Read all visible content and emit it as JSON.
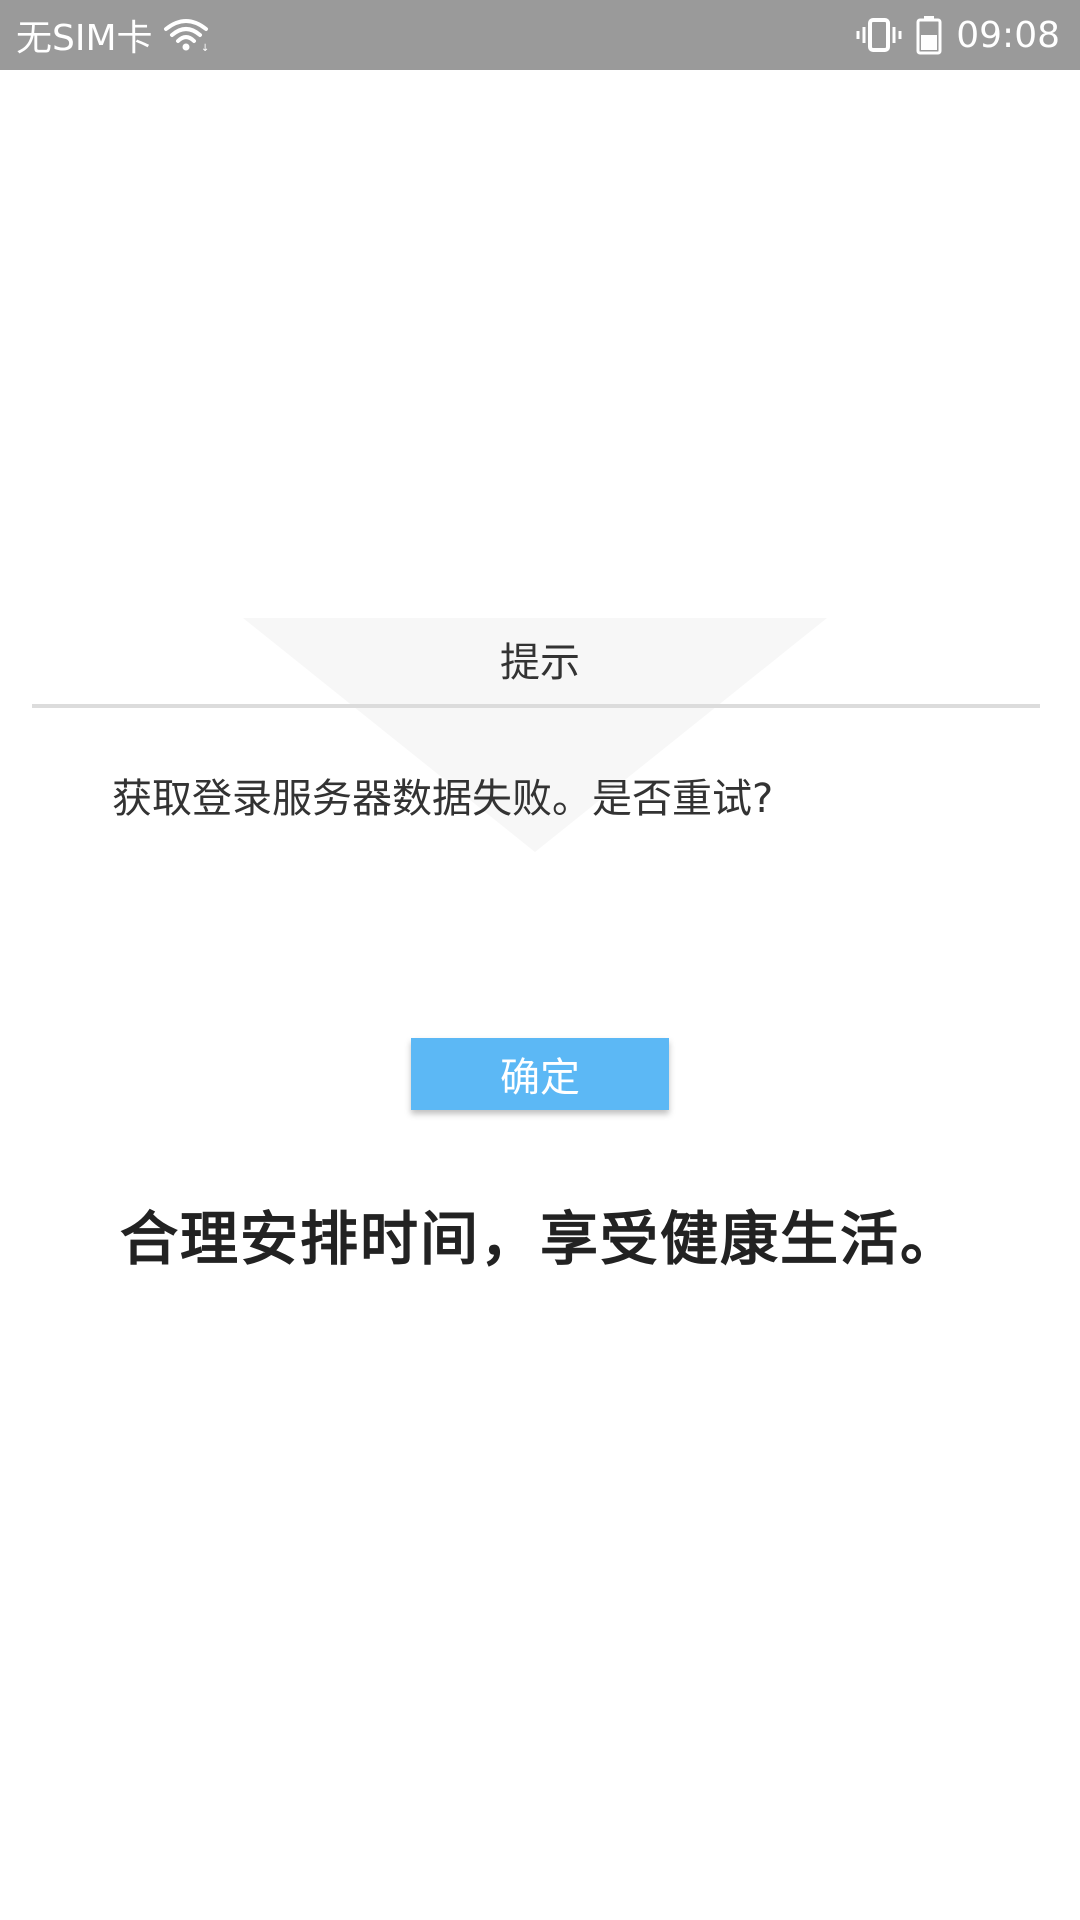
{
  "status_bar": {
    "sim_text": "无SIM卡",
    "time": "09:08",
    "background": "#9a9a9a",
    "icons": [
      "wifi-icon",
      "vibrate-icon",
      "battery-icon"
    ]
  },
  "dialog": {
    "title": "提示",
    "message": "获取登录服务器数据失败。是否重试?",
    "confirm_label": "确定",
    "accent": "#5cb8f5"
  },
  "slogan": "合理安排时间，享受健康生活。"
}
